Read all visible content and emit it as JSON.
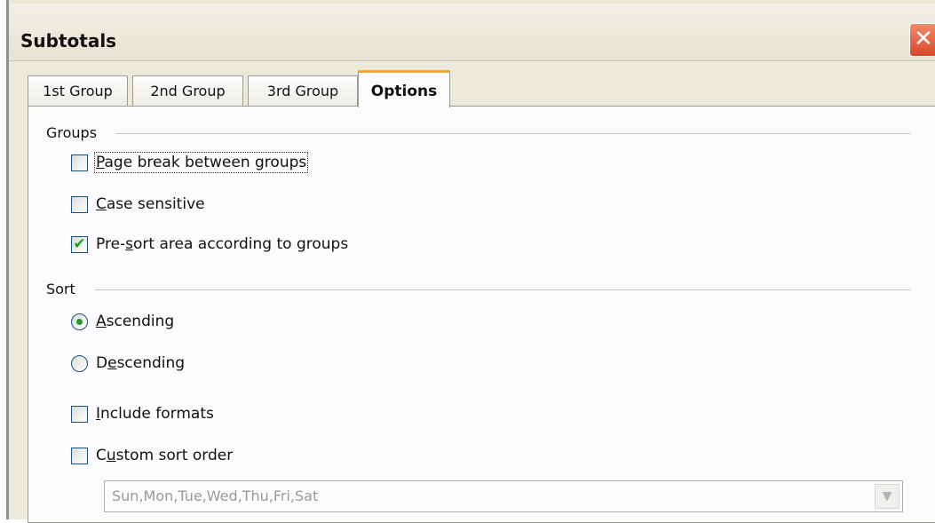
{
  "dialog": {
    "title": "Subtotals",
    "close_glyph": "✕"
  },
  "tabs": [
    {
      "label": "1st Group",
      "active": false
    },
    {
      "label": "2nd Group",
      "active": false
    },
    {
      "label": "3rd Group",
      "active": false
    },
    {
      "label": "Options",
      "active": true
    }
  ],
  "groups": {
    "label": "Groups",
    "options": [
      {
        "pre": "",
        "key": "P",
        "rest": "age break between groups",
        "checked": false
      },
      {
        "pre": "",
        "key": "C",
        "rest": "ase sensitive",
        "checked": false
      },
      {
        "pre": "Pre-",
        "key": "s",
        "rest": "ort area according to groups",
        "checked": true
      }
    ]
  },
  "sort": {
    "label": "Sort",
    "radios": [
      {
        "pre": "",
        "key": "A",
        "rest": "scending",
        "selected": true
      },
      {
        "pre": "D",
        "key": "e",
        "rest": "scending",
        "selected": false
      }
    ],
    "checks": [
      {
        "pre": "",
        "key": "I",
        "rest": "nclude formats",
        "checked": false
      },
      {
        "pre": "C",
        "key": "u",
        "rest": "stom sort order",
        "checked": false
      }
    ],
    "custom_order_value": "Sun,Mon,Tue,Wed,Thu,Fri,Sat"
  },
  "icons": {
    "checkmark": "✔",
    "combo_arrow": "▼"
  }
}
